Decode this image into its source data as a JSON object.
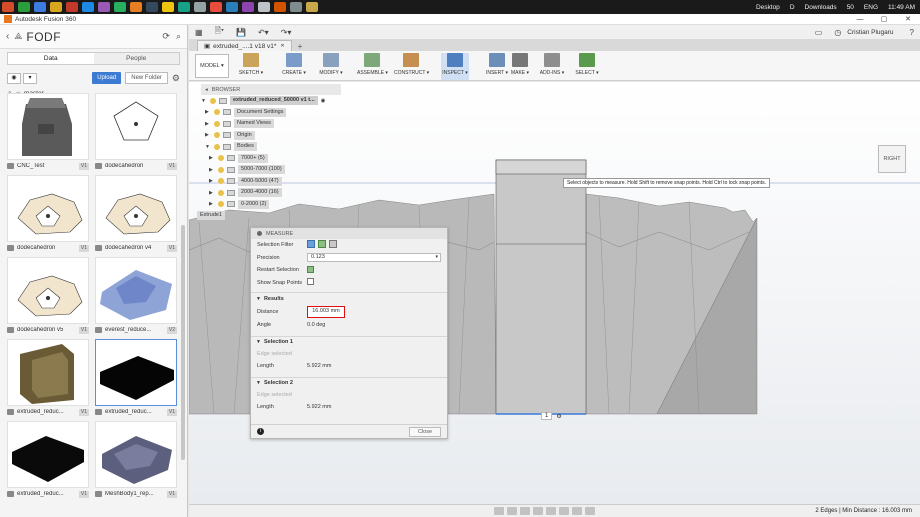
{
  "taskbar": {
    "desktop_label": "Desktop",
    "desktop_letter": "D",
    "downloads_label": "Downloads",
    "battery": "50",
    "language": "ENG",
    "time": "11:49 AM",
    "app_colors": [
      "#d44c2a",
      "#2a9d3c",
      "#3d7be0",
      "#d9a71e",
      "#c0392b",
      "#1e88e5",
      "#9b59b6",
      "#27ae60",
      "#e67e22",
      "#34495e",
      "#f1c40f",
      "#16a085",
      "#95a5a6",
      "#e74c3c",
      "#2980b9",
      "#8e44ad",
      "#bdc3c7",
      "#d35400",
      "#7f8c8d",
      "#c8a84a"
    ]
  },
  "window": {
    "title": "Autodesk Fusion 360",
    "minimize": "—",
    "maximize": "▢",
    "close": "✕"
  },
  "data_panel": {
    "project_name": "FODF",
    "tabs": [
      "Data",
      "People"
    ],
    "upload_label": "Upload",
    "new_folder_label": "New Folder",
    "breadcrumb": "master",
    "files": [
      {
        "name": "CNC_Test",
        "version": "V1",
        "thumb": "cnc"
      },
      {
        "name": "dodecahedron",
        "version": "V1",
        "thumb": "dodeca1"
      },
      {
        "name": "dodecahedron",
        "version": "V1",
        "thumb": "dodeca"
      },
      {
        "name": "dodecahedron v4",
        "version": "V1",
        "thumb": "dodeca"
      },
      {
        "name": "dodecahedron v5",
        "version": "V1",
        "thumb": "dodeca"
      },
      {
        "name": "everest_reduce...",
        "version": "V2",
        "thumb": "everest"
      },
      {
        "name": "extruded_reduc...",
        "version": "V1",
        "thumb": "brown"
      },
      {
        "name": "extruded_reduc...",
        "version": "V1",
        "thumb": "black"
      },
      {
        "name": "extruded_reduc...",
        "version": "V1",
        "thumb": "black2"
      },
      {
        "name": "MeshBody1_rep...",
        "version": "V1",
        "thumb": "mesh"
      }
    ]
  },
  "app_header": {
    "user_name": "Cristian Plugaru",
    "doc_tab": "extruded_....1 v18 v1*",
    "doc_tab_close": "✕"
  },
  "ribbon": {
    "design_label": "MODEL ▾",
    "buttons": [
      {
        "label": "SKETCH ▾",
        "color": "#c9a45a"
      },
      {
        "label": "CREATE ▾",
        "color": "#7a9cc8"
      },
      {
        "label": "MODIFY ▾",
        "color": "#8aa1bd"
      },
      {
        "label": "ASSEMBLE ▾",
        "color": "#7fa87a"
      },
      {
        "label": "CONSTRUCT ▾",
        "color": "#c78f4f"
      },
      {
        "label": "INSPECT ▾",
        "color": "#4f7fbf"
      },
      {
        "label": "INSERT ▾",
        "color": "#6c8fb7"
      },
      {
        "label": "MAKE ▾",
        "color": "#777777"
      },
      {
        "label": "ADD-INS ▾",
        "color": "#8e8e8e"
      },
      {
        "label": "SELECT ▾",
        "color": "#5a9a4e"
      }
    ]
  },
  "browser": {
    "header": "BROWSER",
    "root": "extruded_reduced_50000 v1 t...",
    "items": [
      {
        "label": "Document Settings",
        "depth": 1
      },
      {
        "label": "Named Views",
        "depth": 1
      },
      {
        "label": "Origin",
        "depth": 1
      },
      {
        "label": "Bodies",
        "depth": 1
      },
      {
        "label": "7000+ (5)",
        "depth": 2
      },
      {
        "label": "5000-7000 (100)",
        "depth": 2
      },
      {
        "label": "4000-5000 (47)",
        "depth": 2
      },
      {
        "label": "2000-4000 (16)",
        "depth": 2
      },
      {
        "label": "0-2000 (2)",
        "depth": 2
      }
    ],
    "extrude_label": "Extrude1"
  },
  "viewcube_label": "RIGHT",
  "tooltip": "Select objects to measure. Hold Shift to remove snap points. Hold Ctrl to lock snap points.",
  "measure": {
    "title": "MEASURE",
    "selection_filter_label": "Selection Filter",
    "precision_label": "Precision",
    "precision_value": "0.123",
    "restart_label": "Restart Selection",
    "snap_label": "Show Snap Points",
    "results_header": "Results",
    "distance_label": "Distance",
    "distance_value": "16.003 mm",
    "angle_label": "Angle",
    "angle_value": "0.0 deg",
    "selection1_header": "Selection 1",
    "selection1_hint": "Edge selected",
    "selection1_length_label": "Length",
    "selection1_length": "5.922 mm",
    "selection2_header": "Selection 2",
    "selection2_hint": "Edge selected",
    "selection2_length_label": "Length",
    "selection2_length": "5.922 mm",
    "close_label": "Close"
  },
  "viewport_badge": "1",
  "status_bar": "2 Edges | Min Distance : 16.003 mm"
}
